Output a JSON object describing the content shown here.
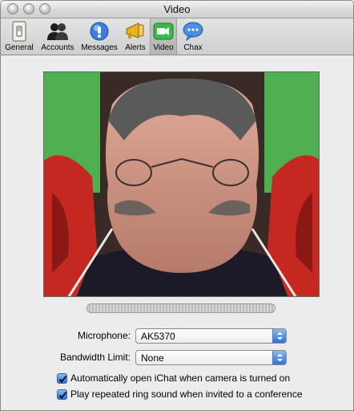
{
  "window": {
    "title": "Video"
  },
  "toolbar": {
    "items": [
      {
        "label": "General",
        "icon": "light-switch-icon"
      },
      {
        "label": "Accounts",
        "icon": "people-icon"
      },
      {
        "label": "Messages",
        "icon": "globe-message-icon"
      },
      {
        "label": "Alerts",
        "icon": "megaphone-icon"
      },
      {
        "label": "Video",
        "icon": "video-camera-icon",
        "selected": true
      },
      {
        "label": "Chax",
        "icon": "chat-bubble-icon"
      }
    ]
  },
  "video": {
    "microphone_label": "Microphone:",
    "microphone_value": "AK5370",
    "bandwidth_label": "Bandwidth Limit:",
    "bandwidth_value": "None",
    "auto_open_label": "Automatically open iChat when camera is turned on",
    "auto_open_checked": true,
    "ring_label": "Play repeated ring sound when invited to a conference",
    "ring_checked": true
  },
  "colors": {
    "accent_blue": "#2e74d6",
    "window_bg": "#ececec"
  }
}
